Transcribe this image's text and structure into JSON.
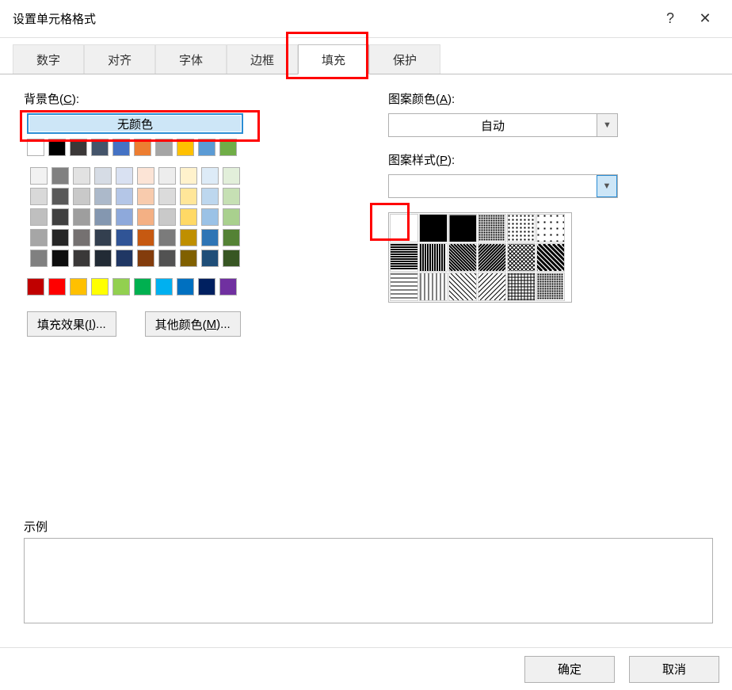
{
  "title": "设置单元格格式",
  "help_icon": "?",
  "close_icon": "✕",
  "tabs": [
    "数字",
    "对齐",
    "字体",
    "边框",
    "填充",
    "保护"
  ],
  "active_tab_index": 4,
  "left": {
    "bgcolor_label_pre": "背景色(",
    "bgcolor_label_key": "C",
    "bgcolor_label_post": "):",
    "no_color": "无颜色",
    "fill_effects_pre": "填充效果(",
    "fill_effects_key": "I",
    "fill_effects_post": ")...",
    "more_colors_pre": "其他颜色(",
    "more_colors_key": "M",
    "more_colors_post": ")..."
  },
  "right": {
    "pattern_color_label_pre": "图案颜色(",
    "pattern_color_label_key": "A",
    "pattern_color_label_post": "):",
    "pattern_color_value": "自动",
    "pattern_style_label_pre": "图案样式(",
    "pattern_style_label_key": "P",
    "pattern_style_label_post": "):",
    "pattern_style_value": ""
  },
  "sample_label": "示例",
  "ok": "确定",
  "cancel": "取消",
  "colors": {
    "standard_row": [
      "#ffffff",
      "#000000",
      "#3b3838",
      "#44546a",
      "#4472c4",
      "#ed7d31",
      "#a5a5a5",
      "#ffc000",
      "#5b9bd5",
      "#70ad47"
    ],
    "theme_rows": [
      [
        "#f2f2f2",
        "#808080",
        "#e2e2e2",
        "#d6dce5",
        "#d9e1f2",
        "#fce4d6",
        "#ededed",
        "#fff2cc",
        "#ddebf7",
        "#e2efda"
      ],
      [
        "#d9d9d9",
        "#595959",
        "#c9c9c9",
        "#acb9ca",
        "#b4c6e7",
        "#f8cbad",
        "#dbdbdb",
        "#ffe699",
        "#bdd7ee",
        "#c6e0b4"
      ],
      [
        "#bfbfbf",
        "#404040",
        "#9e9e9e",
        "#8497b0",
        "#8ea9db",
        "#f4b084",
        "#c9c9c9",
        "#ffd966",
        "#9bc2e6",
        "#a9d08e"
      ],
      [
        "#a6a6a6",
        "#262626",
        "#757171",
        "#333f4f",
        "#305496",
        "#c65911",
        "#7b7b7b",
        "#bf8f00",
        "#2f75b5",
        "#548235"
      ],
      [
        "#808080",
        "#0d0d0d",
        "#3a3838",
        "#222b35",
        "#203764",
        "#833c0c",
        "#525252",
        "#806000",
        "#1f4e78",
        "#375623"
      ]
    ],
    "accent_row": [
      "#c00000",
      "#ff0000",
      "#ffc000",
      "#ffff00",
      "#92d050",
      "#00b050",
      "#00b0f0",
      "#0070c0",
      "#002060",
      "#7030a0"
    ]
  }
}
